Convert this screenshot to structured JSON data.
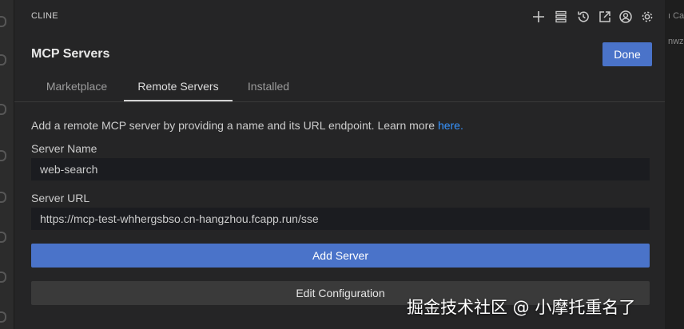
{
  "app": {
    "title": "CLINE"
  },
  "toolbar": {
    "icons": [
      "plus-icon",
      "server-list-icon",
      "history-icon",
      "popout-icon",
      "account-icon",
      "settings-gear-icon"
    ]
  },
  "header": {
    "title": "MCP Servers",
    "done_label": "Done"
  },
  "tabs": [
    {
      "label": "Marketplace",
      "active": false
    },
    {
      "label": "Remote Servers",
      "active": true
    },
    {
      "label": "Installed",
      "active": false
    }
  ],
  "intro": {
    "text": "Add a remote MCP server by providing a name and its URL endpoint. Learn more ",
    "link": "here."
  },
  "form": {
    "server_name": {
      "label": "Server Name",
      "value": "web-search"
    },
    "server_url": {
      "label": "Server URL",
      "value": "https://mcp-test-whhergsbso.cn-hangzhou.fcapp.run/sse"
    }
  },
  "actions": {
    "add_server": "Add Server",
    "edit_configuration": "Edit Configuration"
  },
  "right_strip": {
    "line1": "ı Ca",
    "line2": "nwz"
  },
  "watermark": "掘金技术社区 @ 小摩托重名了",
  "colors": {
    "accent": "#4a73c9",
    "link": "#3794ff",
    "background": "#252526"
  }
}
